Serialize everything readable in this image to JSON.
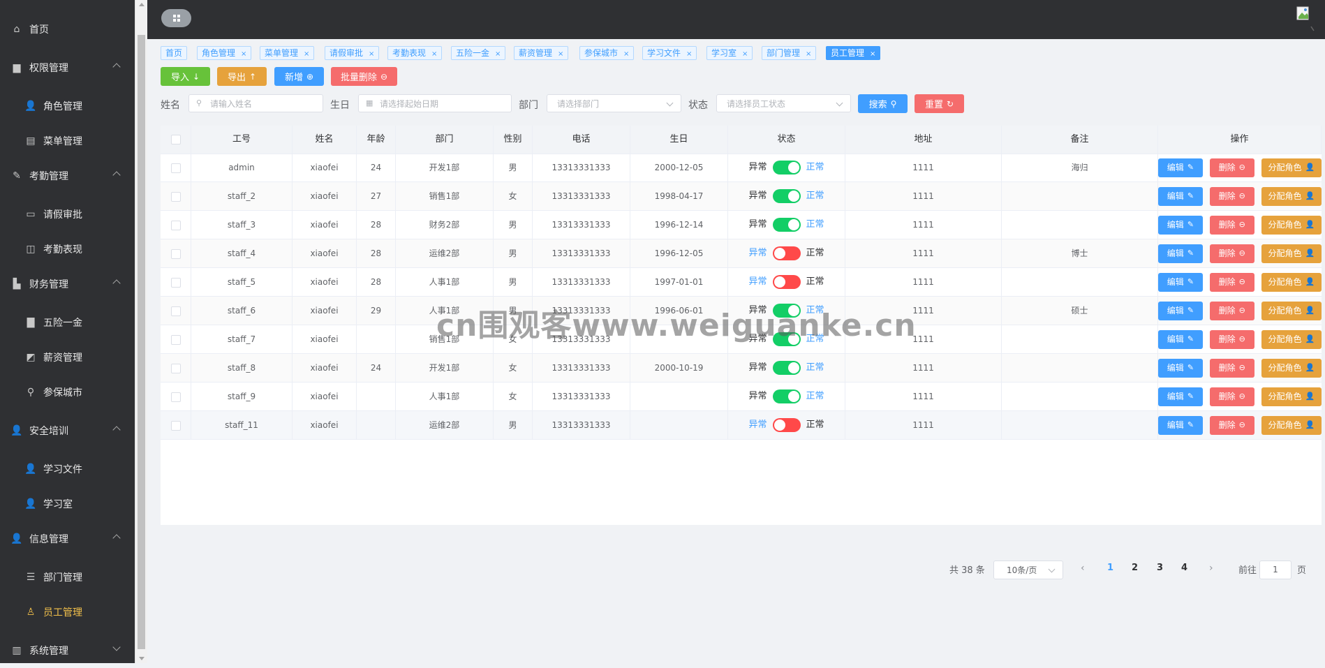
{
  "sidebar": {
    "items": [
      {
        "label": "首页",
        "icon": "home-icon",
        "type": "top"
      },
      {
        "label": "权限管理",
        "icon": "briefcase-icon",
        "type": "group",
        "expanded": true
      },
      {
        "label": "角色管理",
        "icon": "user-icon",
        "type": "sub"
      },
      {
        "label": "菜单管理",
        "icon": "menu-book-icon",
        "type": "sub"
      },
      {
        "label": "考勤管理",
        "icon": "pen-icon",
        "type": "group",
        "expanded": true
      },
      {
        "label": "请假审批",
        "icon": "suitcase-icon",
        "type": "sub"
      },
      {
        "label": "考勤表现",
        "icon": "book-icon",
        "type": "sub"
      },
      {
        "label": "财务管理",
        "icon": "factory-icon",
        "type": "group",
        "expanded": true
      },
      {
        "label": "五险一金",
        "icon": "bar-chart-icon",
        "type": "sub"
      },
      {
        "label": "薪资管理",
        "icon": "chart-board-icon",
        "type": "sub"
      },
      {
        "label": "参保城市",
        "icon": "location-user-icon",
        "type": "sub"
      },
      {
        "label": "安全培训",
        "icon": "user-icon",
        "type": "group",
        "expanded": true
      },
      {
        "label": "学习文件",
        "icon": "user-icon",
        "type": "sub"
      },
      {
        "label": "学习室",
        "icon": "user-icon",
        "type": "sub"
      },
      {
        "label": "信息管理",
        "icon": "user-icon",
        "type": "group",
        "expanded": true
      },
      {
        "label": "部门管理",
        "icon": "sliders-icon",
        "type": "sub"
      },
      {
        "label": "员工管理",
        "icon": "user-outline-icon",
        "type": "sub",
        "active": true
      },
      {
        "label": "系统管理",
        "icon": "columns-icon",
        "type": "group",
        "expanded": false
      }
    ]
  },
  "tags": [
    {
      "label": "首页",
      "closable": false
    },
    {
      "label": "角色管理",
      "closable": true
    },
    {
      "label": "菜单管理",
      "closable": true
    },
    {
      "label": "请假审批",
      "closable": true
    },
    {
      "label": "考勤表现",
      "closable": true
    },
    {
      "label": "五险一金",
      "closable": true
    },
    {
      "label": "薪资管理",
      "closable": true
    },
    {
      "label": "参保城市",
      "closable": true
    },
    {
      "label": "学习文件",
      "closable": true
    },
    {
      "label": "学习室",
      "closable": true
    },
    {
      "label": "部门管理",
      "closable": true
    },
    {
      "label": "员工管理",
      "closable": true,
      "active": true
    }
  ],
  "toolbar": {
    "import_label": "导入",
    "export_label": "导出",
    "add_label": "新增",
    "batch_delete_label": "批量删除"
  },
  "search": {
    "name_label": "姓名",
    "name_placeholder": "请输入姓名",
    "birthday_label": "生日",
    "birthday_placeholder": "请选择起始日期",
    "dept_label": "部门",
    "dept_placeholder": "请选择部门",
    "status_label": "状态",
    "status_placeholder": "请选择员工状态",
    "search_label": "搜索",
    "reset_label": "重置"
  },
  "table": {
    "columns": [
      "工号",
      "姓名",
      "年龄",
      "部门",
      "性别",
      "电话",
      "生日",
      "状态",
      "地址",
      "备注",
      "操作"
    ],
    "status_off_label": "异常",
    "status_on_label": "正常",
    "edit_label": "编辑",
    "delete_label": "删除",
    "assign_label": "分配角色",
    "rows": [
      {
        "id": "admin",
        "name": "xiaofei",
        "age": "24",
        "dept": "开发1部",
        "gender": "男",
        "phone": "13313331333",
        "birthday": "2000-12-05",
        "enabled": true,
        "address": "1111",
        "remark": "海归"
      },
      {
        "id": "staff_2",
        "name": "xiaofei",
        "age": "27",
        "dept": "销售1部",
        "gender": "女",
        "phone": "13313331333",
        "birthday": "1998-04-17",
        "enabled": true,
        "address": "1111",
        "remark": ""
      },
      {
        "id": "staff_3",
        "name": "xiaofei",
        "age": "28",
        "dept": "财务2部",
        "gender": "男",
        "phone": "13313331333",
        "birthday": "1996-12-14",
        "enabled": true,
        "address": "1111",
        "remark": ""
      },
      {
        "id": "staff_4",
        "name": "xiaofei",
        "age": "28",
        "dept": "运维2部",
        "gender": "男",
        "phone": "13313331333",
        "birthday": "1996-12-05",
        "enabled": false,
        "address": "1111",
        "remark": "博士"
      },
      {
        "id": "staff_5",
        "name": "xiaofei",
        "age": "28",
        "dept": "人事1部",
        "gender": "男",
        "phone": "13313331333",
        "birthday": "1997-01-01",
        "enabled": false,
        "address": "1111",
        "remark": ""
      },
      {
        "id": "staff_6",
        "name": "xiaofei",
        "age": "29",
        "dept": "人事1部",
        "gender": "男",
        "phone": "13313331333",
        "birthday": "1996-06-01",
        "enabled": true,
        "address": "1111",
        "remark": "硕士"
      },
      {
        "id": "staff_7",
        "name": "xiaofei",
        "age": "",
        "dept": "销售1部",
        "gender": "女",
        "phone": "13313331333",
        "birthday": "",
        "enabled": true,
        "address": "1111",
        "remark": ""
      },
      {
        "id": "staff_8",
        "name": "xiaofei",
        "age": "24",
        "dept": "开发1部",
        "gender": "女",
        "phone": "13313331333",
        "birthday": "2000-10-19",
        "enabled": true,
        "address": "1111",
        "remark": ""
      },
      {
        "id": "staff_9",
        "name": "xiaofei",
        "age": "",
        "dept": "人事1部",
        "gender": "女",
        "phone": "13313331333",
        "birthday": "",
        "enabled": true,
        "address": "1111",
        "remark": ""
      },
      {
        "id": "staff_11",
        "name": "xiaofei",
        "age": "",
        "dept": "运维2部",
        "gender": "男",
        "phone": "13313331333",
        "birthday": "",
        "enabled": false,
        "address": "1111",
        "remark": ""
      }
    ]
  },
  "pagination": {
    "total_text": "共 38 条",
    "page_size": "10条/页",
    "pages": [
      "1",
      "2",
      "3",
      "4"
    ],
    "current": "1",
    "goto_label": "前往",
    "goto_value": "1",
    "page_suffix": "页"
  },
  "watermark": "cn围观客www.weiguanke.cn",
  "colors": {
    "sidebar_bg": "#2f3033",
    "active_menu": "#f2c04b",
    "primary": "#409eff",
    "success": "#67c23a",
    "warning": "#e6a23c",
    "danger": "#f56c6c",
    "switch_on": "#13ce66",
    "switch_off": "#ff4949"
  }
}
